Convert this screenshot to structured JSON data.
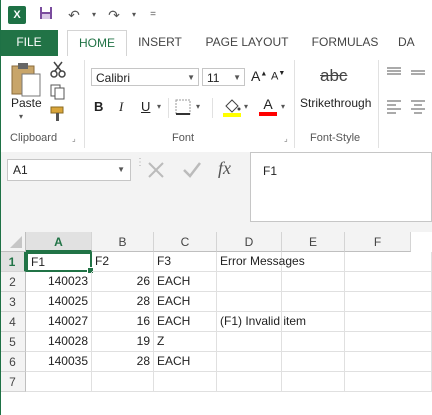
{
  "app": {
    "logo": "X"
  },
  "quick_access": {
    "save": "💾",
    "undo": "↶",
    "redo": "↷",
    "customize": "="
  },
  "tabs": [
    "FILE",
    "HOME",
    "INSERT",
    "PAGE LAYOUT",
    "FORMULAS",
    "DA"
  ],
  "ribbon": {
    "clipboard": {
      "paste_label": "Paste",
      "group_label": "Clipboard"
    },
    "font": {
      "name": "Calibri",
      "size": "11",
      "bold": "B",
      "italic": "I",
      "underline": "U",
      "group_label": "Font",
      "grow": "A",
      "shrink": "A"
    },
    "font_style": {
      "strikethrough_icon_text": "abc",
      "strikethrough_label": "Strikethrough",
      "group_label": "Font-Style"
    }
  },
  "formula_bar": {
    "name_box": "A1",
    "fx": "fx",
    "value": "F1"
  },
  "grid": {
    "columns": [
      "A",
      "B",
      "C",
      "D",
      "E",
      "F"
    ],
    "rows": [
      {
        "n": "1",
        "A": "F1",
        "B": "F2",
        "C": "F3",
        "D": "Error Messages"
      },
      {
        "n": "2",
        "A": "140023",
        "B": "26",
        "C": "EACH",
        "D": ""
      },
      {
        "n": "3",
        "A": "140025",
        "B": "28",
        "C": "EACH",
        "D": ""
      },
      {
        "n": "4",
        "A": "140027",
        "B": "16",
        "C": "EACH",
        "D": "(F1) Invalid item"
      },
      {
        "n": "5",
        "A": "140028",
        "B": "19",
        "C": "Z",
        "D": ""
      },
      {
        "n": "6",
        "A": "140035",
        "B": "28",
        "C": "EACH",
        "D": ""
      },
      {
        "n": "7",
        "A": "",
        "B": "",
        "C": "",
        "D": ""
      }
    ]
  },
  "colors": {
    "excel_green": "#217346",
    "highlight_yellow": "#ffff00",
    "font_red": "#ff0000"
  }
}
